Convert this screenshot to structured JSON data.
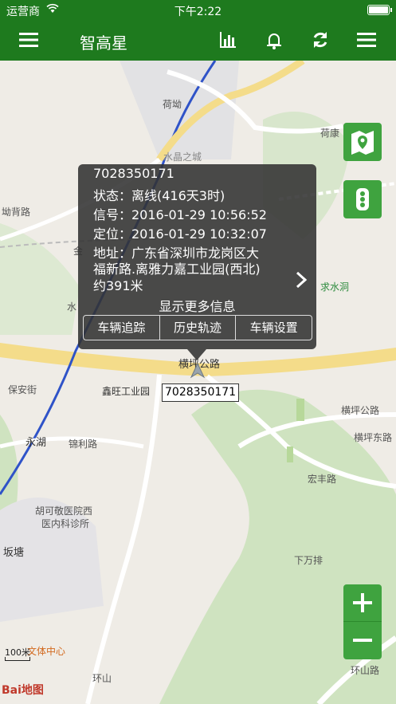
{
  "status_bar": {
    "carrier": "运营商",
    "time": "下午2:22"
  },
  "nav": {
    "title": "智高星",
    "icons": [
      "menu-icon",
      "bar-chart-icon",
      "bell-icon",
      "refresh-icon",
      "list-menu-icon"
    ]
  },
  "popup": {
    "device_id": "7028350171",
    "status": "状态：离线(416天3时)",
    "signal": "信号：2016-01-29 10:56:52",
    "location_time": "定位：2016-01-29 10:32:07",
    "address_line1": "地址：广东省深圳市龙岗区大",
    "address_line2": "福新路.离雅力嘉工业园(西北)",
    "address_line3": "约391米",
    "more": "显示更多信息",
    "buttons": [
      "车辆追踪",
      "历史轨迹",
      "车辆设置"
    ]
  },
  "car_label": "7028350171",
  "map_labels": {
    "hekan": "荷坳",
    "shuijing": "水晶之城",
    "kandoulu": "坳背路",
    "hekang": "荷康",
    "qiushuidong": "求水洞",
    "hengpinggonglu": "横坪公路",
    "xinwang": "鑫旺工业园",
    "baoan": "保安街",
    "yonghu": "永湖",
    "jinlilu": "锦利路",
    "hengpinggonglu2": "横坪公路",
    "hengpingdonglu": "横坪东路",
    "hongfenglu": "宏丰路",
    "hospital1": "胡可敬医院西",
    "hospital2": "医内科诊所",
    "xiawanpai": "下万排",
    "tiyuzhongxin": "文体中心",
    "huanshan": "环山路",
    "huanshan2": "环山",
    "poa": "坂塘",
    "jin": "金",
    "shui": "水"
  },
  "scale": "100米",
  "attribution": "Bai地图",
  "colors": {
    "green": "#1e7a1e",
    "button_green": "#3fa33f"
  }
}
